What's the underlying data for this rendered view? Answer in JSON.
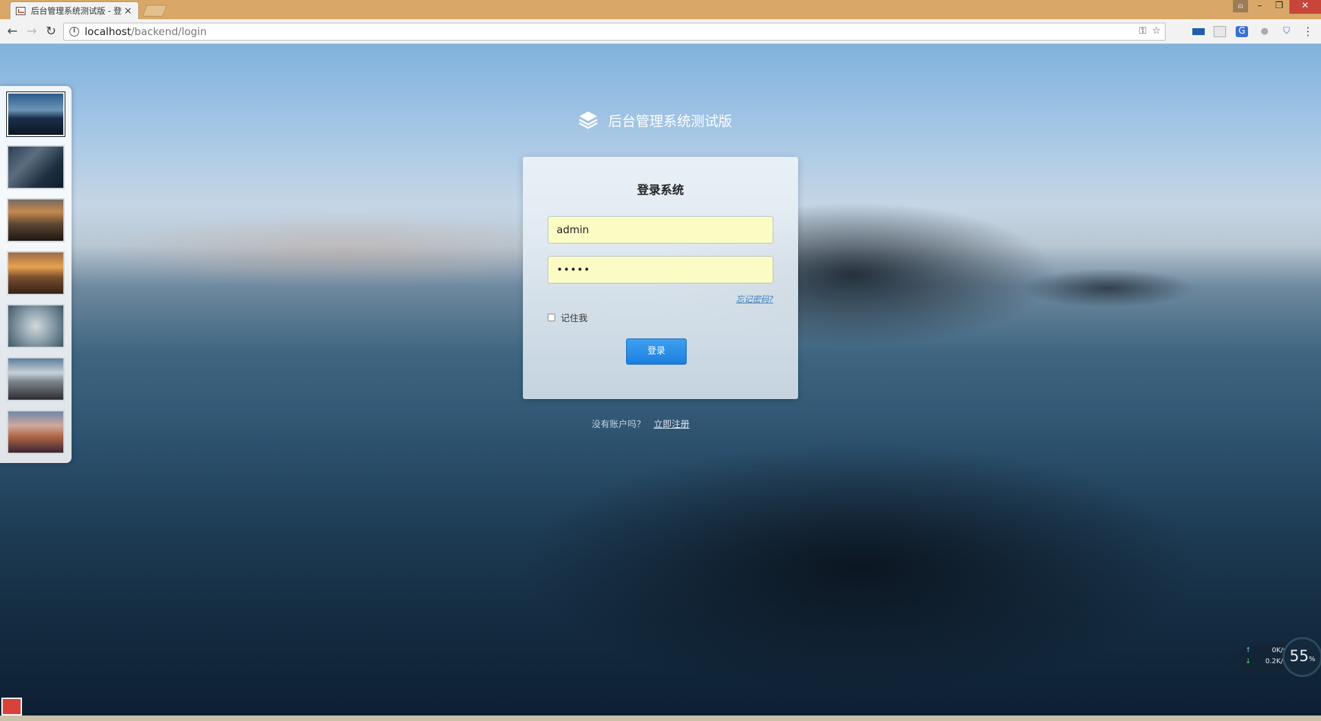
{
  "browser": {
    "tab_title": "后台管理系统测试版 - 登",
    "tab_close": "×",
    "url_host": "localhost",
    "url_path": "/backend/login",
    "back_glyph": "←",
    "forward_glyph": "→",
    "reload_glyph": "↻",
    "minimize_glyph": "–",
    "restore_glyph": "❐",
    "close_glyph": "✕",
    "info_glyph": "i",
    "key_glyph": "⚿",
    "star_glyph": "☆",
    "menu_glyph": "⋮"
  },
  "page": {
    "brand_title": "后台管理系统测试版",
    "login_title": "登录系统",
    "username_value": "admin",
    "password_value": "•••••",
    "forgot_password": "忘记密码?",
    "remember_me": "记住我",
    "login_button": "登录",
    "no_account": "没有账户吗？",
    "register_link": "立即注册"
  },
  "thumbnails": {
    "count": 7,
    "active_index": 0
  },
  "speed_widget": {
    "upload": "0K/s",
    "download": "0.2K/s",
    "percent": "55",
    "percent_unit": "%"
  },
  "colors": {
    "accent": "#1a7fe0",
    "titlebar": "#d9a868",
    "autofill": "#fbfcc4"
  }
}
